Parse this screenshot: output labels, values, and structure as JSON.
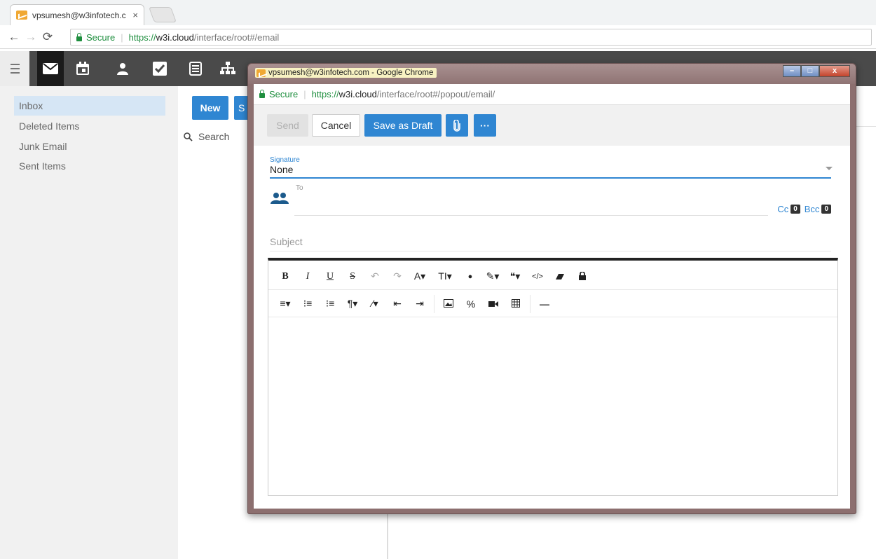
{
  "browser": {
    "tab_title": "vpsumesh@w3infotech.c",
    "tab_close": "×",
    "secure_label": "Secure",
    "url_scheme": "https://",
    "url_host": "w3i.cloud",
    "url_path": "/interface/root#/email"
  },
  "app_toolbar": {
    "icons": [
      "menu-icon",
      "mail-icon",
      "calendar-icon",
      "contacts-icon",
      "tasks-icon",
      "notes-icon",
      "org-chart-icon"
    ],
    "active": "mail-icon"
  },
  "sidebar": {
    "folders": [
      {
        "label": "Inbox",
        "selected": true
      },
      {
        "label": "Deleted Items",
        "selected": false
      },
      {
        "label": "Junk Email",
        "selected": false
      },
      {
        "label": "Sent Items",
        "selected": false
      }
    ]
  },
  "mail_list": {
    "new_label": "New",
    "second_button_partial": "S",
    "search_placeholder": "Search"
  },
  "popup": {
    "window_title": "vpsumesh@w3infotech.com - Google Chrome",
    "secure_label": "Secure",
    "url_scheme": "https://",
    "url_host": "w3i.cloud",
    "url_path": "/interface/root#/popout/email/",
    "toolbar": {
      "send_label": "Send",
      "cancel_label": "Cancel",
      "draft_label": "Save as Draft",
      "more_label": "···"
    },
    "signature": {
      "label": "Signature",
      "value": "None"
    },
    "to_label": "To",
    "cc_label": "Cc",
    "cc_count": "0",
    "bcc_label": "Bcc",
    "bcc_count": "0",
    "subject_placeholder": "Subject",
    "editor": {
      "row1": [
        "B",
        "I",
        "U",
        "S",
        "↶",
        "↷",
        "A▾",
        "TI▾",
        "●",
        "✎▾",
        "❝▾",
        "</>",
        "eraser",
        "lock"
      ],
      "row2": [
        "align▾",
        "ol",
        "ul",
        "¶▾",
        "magic▾",
        "outdent",
        "indent",
        "image",
        "link",
        "video",
        "table",
        "—"
      ]
    }
  },
  "colors": {
    "accent": "#2f86d2",
    "toolbar_dark": "#4a4a4a",
    "sidebar_selected": "#d6e6f5",
    "secure_green": "#1e8e3e"
  }
}
